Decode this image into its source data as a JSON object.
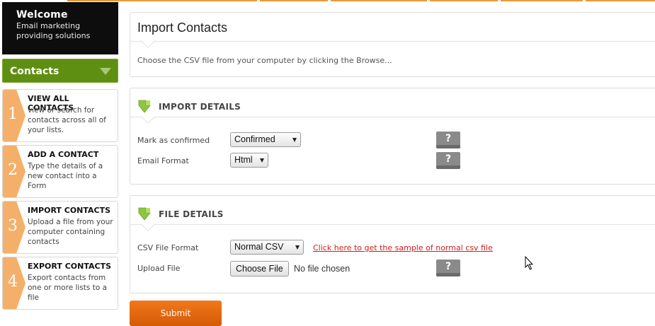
{
  "welcome": {
    "title": "Welcome",
    "subtitle_line1": "Email marketing",
    "subtitle_line2": "providing solutions"
  },
  "sidebar": {
    "header": "Contacts",
    "steps": [
      {
        "number": "1",
        "title": "VIEW ALL CONTACTS",
        "description": "view or search for contacts across all of your lists."
      },
      {
        "number": "2",
        "title": "ADD A CONTACT",
        "description": "Type the details of a new contact into a Form"
      },
      {
        "number": "3",
        "title": "IMPORT CONTACTS",
        "description": "Upload a file from your computer containing contacts"
      },
      {
        "number": "4",
        "title": "EXPORT CONTACTS",
        "description": "Export contacts from one or more lists to a file"
      }
    ]
  },
  "main": {
    "title": "Import Contacts",
    "description": "Choose the CSV file from your computer by clicking the Browse...",
    "import_details": {
      "heading": "IMPORT DETAILS",
      "mark_confirmed_label": "Mark as confirmed",
      "mark_confirmed_value": "Confirmed",
      "email_format_label": "Email Format",
      "email_format_value": "Html",
      "help_label": "?"
    },
    "file_details": {
      "heading": "FILE DETAILS",
      "csv_format_label": "CSV File Format",
      "csv_format_value": "Normal CSV",
      "sample_link": "Click here to get the sample of normal csv file",
      "upload_label": "Upload File",
      "choose_file_button": "Choose File",
      "no_file_text": "No file chosen",
      "help_label": "?"
    },
    "submit_label": "Submit"
  },
  "colors": {
    "accent_orange": "#e8762a",
    "sidebar_green": "#5f8f12",
    "link_red": "#d11c1c",
    "step_chevron": "#f4b06a",
    "arrow_green": "#8dc63f"
  },
  "icons": {
    "section_arrow": "green-down-arrow-icon",
    "contacts_toggle": "triangle-down-icon",
    "help": "question-mark-icon",
    "cursor": "mouse-pointer-icon"
  }
}
